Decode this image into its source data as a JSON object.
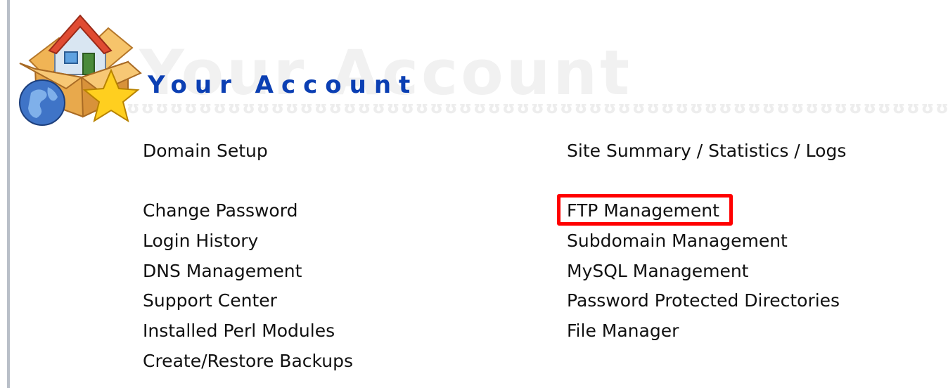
{
  "header": {
    "title": "Your Account",
    "title_color": "#0b3fb3",
    "logo_icon": "house-box-globe-star-icon"
  },
  "links_left": [
    {
      "label": "Domain Setup"
    },
    {
      "label": "Change Password"
    },
    {
      "label": "Login History"
    },
    {
      "label": "DNS Management"
    },
    {
      "label": "Support Center"
    },
    {
      "label": "Installed Perl Modules"
    },
    {
      "label": "Create/Restore Backups"
    }
  ],
  "links_right": [
    {
      "label": "Site Summary / Statistics / Logs"
    },
    {
      "label": "FTP Management",
      "highlighted": true
    },
    {
      "label": "Subdomain Management"
    },
    {
      "label": "MySQL Management"
    },
    {
      "label": "Password Protected Directories"
    },
    {
      "label": "File Manager"
    }
  ],
  "highlight_color": "#ff0000"
}
